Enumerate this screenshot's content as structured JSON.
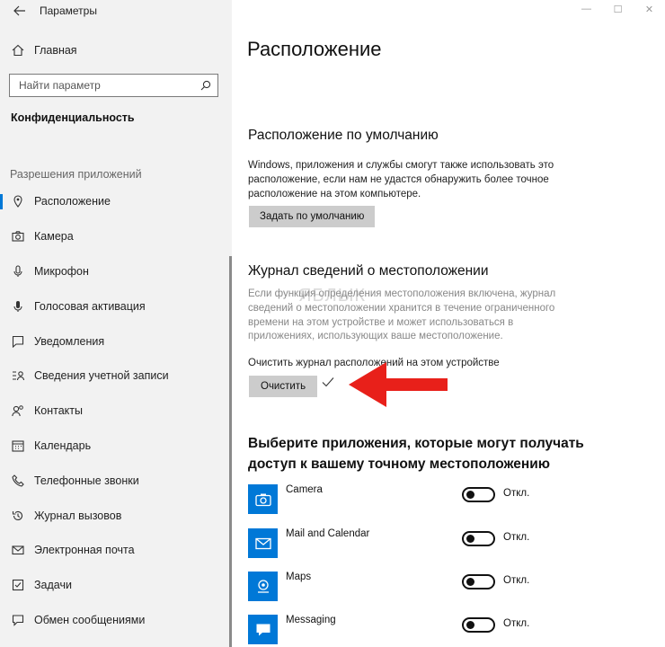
{
  "window": {
    "title": "Параметры",
    "controls": {
      "minimize": "—",
      "maximize": "☐",
      "close": "✕"
    }
  },
  "sidebar": {
    "home_label": "Главная",
    "search_placeholder": "Найти параметр",
    "category": "Конфиденциальность",
    "section_label": "Разрешения приложений",
    "items": [
      {
        "label": "Расположение",
        "icon": "location-icon",
        "active": true
      },
      {
        "label": "Камера",
        "icon": "camera-icon"
      },
      {
        "label": "Микрофон",
        "icon": "microphone-icon"
      },
      {
        "label": "Голосовая активация",
        "icon": "voice-activation-icon"
      },
      {
        "label": "Уведомления",
        "icon": "notifications-icon"
      },
      {
        "label": "Сведения учетной записи",
        "icon": "account-info-icon"
      },
      {
        "label": "Контакты",
        "icon": "contacts-icon"
      },
      {
        "label": "Календарь",
        "icon": "calendar-icon"
      },
      {
        "label": "Телефонные звонки",
        "icon": "phone-icon"
      },
      {
        "label": "Журнал вызовов",
        "icon": "call-history-icon"
      },
      {
        "label": "Электронная почта",
        "icon": "email-icon"
      },
      {
        "label": "Задачи",
        "icon": "tasks-icon"
      },
      {
        "label": "Обмен сообщениями",
        "icon": "messaging-icon"
      }
    ]
  },
  "main": {
    "title": "Расположение",
    "default_location": {
      "heading": "Расположение по умолчанию",
      "description": "Windows, приложения и службы смогут также использовать это расположение, если нам не удастся обнаружить более точное расположение на этом компьютере.",
      "button_label": "Задать по умолчанию"
    },
    "history": {
      "heading": "Журнал сведений о местоположении",
      "description": "Если функция определения местоположения включена, журнал сведений о местоположении хранится в течение ограниченного времени на этом устройстве и может использоваться в приложениях, использующих ваше местоположение.",
      "clear_label": "Очистить журнал расположений на этом устройстве",
      "clear_button": "Очистить",
      "watermark": "ЯБЛЫК"
    },
    "apps_section": {
      "heading": "Выберите приложения, которые могут получать доступ к вашему точному местоположению",
      "apps": [
        {
          "name": "Camera",
          "icon": "camera-app-icon",
          "state": "Откл."
        },
        {
          "name": "Mail and Calendar",
          "icon": "mail-app-icon",
          "state": "Откл."
        },
        {
          "name": "Maps",
          "icon": "maps-app-icon",
          "state": "Откл."
        },
        {
          "name": "Messaging",
          "icon": "messaging-app-icon",
          "state": "Откл."
        }
      ]
    }
  },
  "colors": {
    "accent": "#0078d7",
    "sidebar_bg": "#f2f2f2",
    "button_bg": "#cccccc",
    "arrow": "#e8201a"
  }
}
